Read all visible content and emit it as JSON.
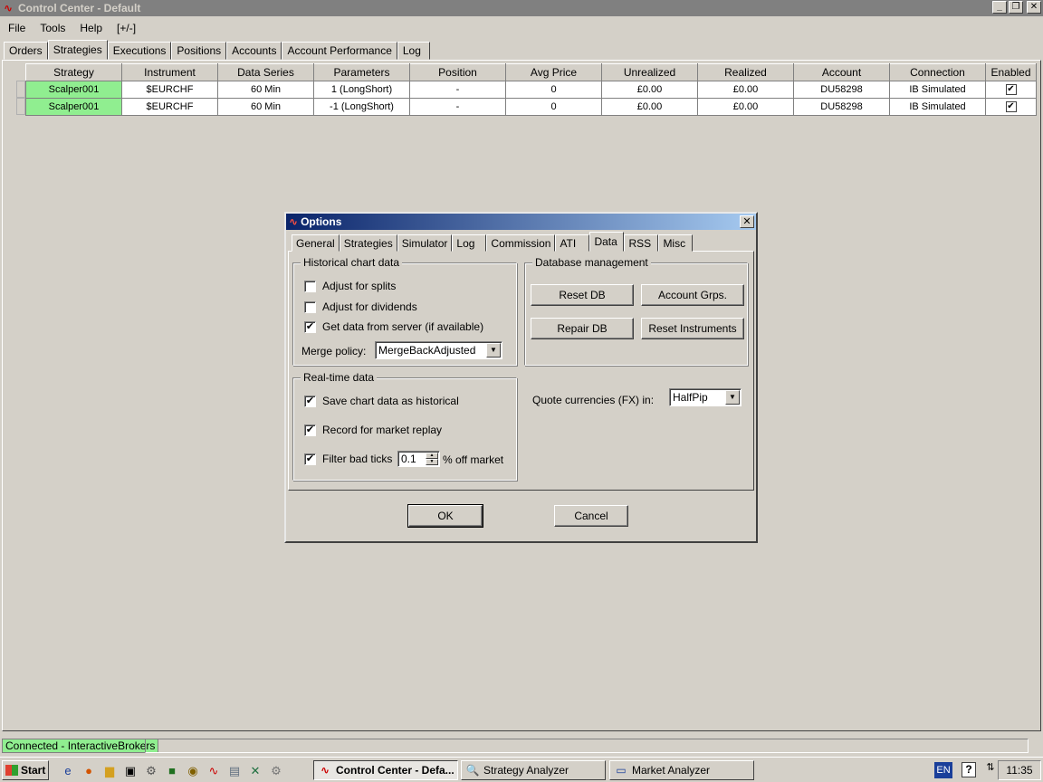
{
  "window": {
    "title": "Control Center - Default"
  },
  "menu": [
    "File",
    "Tools",
    "Help",
    "[+/-]"
  ],
  "main_tabs": [
    "Orders",
    "Strategies",
    "Executions",
    "Positions",
    "Accounts",
    "Account Performance",
    "Log"
  ],
  "active_main_tab": "Strategies",
  "grid": {
    "columns": [
      "Strategy",
      "Instrument",
      "Data Series",
      "Parameters",
      "Position",
      "Avg Price",
      "Unrealized",
      "Realized",
      "Account",
      "Connection",
      "Enabled"
    ],
    "rows": [
      {
        "strategy": "Scalper001",
        "instrument": "$EURCHF",
        "data_series": "60 Min",
        "parameters": "1 (LongShort)",
        "position": "-",
        "avg_price": "0",
        "unrealized": "£0.00",
        "realized": "£0.00",
        "account": "DU58298",
        "connection": "IB Simulated",
        "enabled": "✔"
      },
      {
        "strategy": "Scalper001",
        "instrument": "$EURCHF",
        "data_series": "60 Min",
        "parameters": "-1 (LongShort)",
        "position": "-",
        "avg_price": "0",
        "unrealized": "£0.00",
        "realized": "£0.00",
        "account": "DU58298",
        "connection": "IB Simulated",
        "enabled": "✔"
      }
    ]
  },
  "dialog": {
    "title": "Options",
    "tabs": [
      "General",
      "Strategies",
      "Simulator",
      "Log",
      "Commission",
      "ATI",
      "Data",
      "RSS",
      "Misc"
    ],
    "active_tab": "Data",
    "historical": {
      "label": "Historical chart data",
      "adjust_splits": "Adjust for splits",
      "adjust_dividends": "Adjust for dividends",
      "get_from_server": "Get data from server (if available)",
      "get_from_server_checked": "✔",
      "merge_policy_label": "Merge policy:",
      "merge_policy_value": "MergeBackAdjusted"
    },
    "realtime": {
      "label": "Real-time data",
      "save_historical": "Save chart data as historical",
      "save_historical_checked": "✔",
      "record_replay": "Record for market replay",
      "record_replay_checked": "✔",
      "filter_bad_ticks": "Filter bad ticks",
      "filter_bad_ticks_checked": "✔",
      "filter_value": "0.1",
      "filter_suffix": "% off market"
    },
    "database": {
      "label": "Database management",
      "reset_db": "Reset DB",
      "account_grps": "Account Grps.",
      "repair_db": "Repair DB",
      "reset_instruments": "Reset Instruments"
    },
    "quote": {
      "label": "Quote currencies (FX) in:",
      "value": "HalfPip"
    },
    "ok": "OK",
    "cancel": "Cancel"
  },
  "status": {
    "connection": "Connected - InteractiveBrokers"
  },
  "taskbar": {
    "start": "Start",
    "tasks": [
      "Control Center - Defa...",
      "Strategy Analyzer",
      "Market Analyzer"
    ],
    "lang": "EN",
    "clock": "11:35"
  },
  "colors": {
    "strategy_cell": "#90ee90",
    "dialog_title": "#0a246a",
    "status_connected": "#90ee90"
  }
}
